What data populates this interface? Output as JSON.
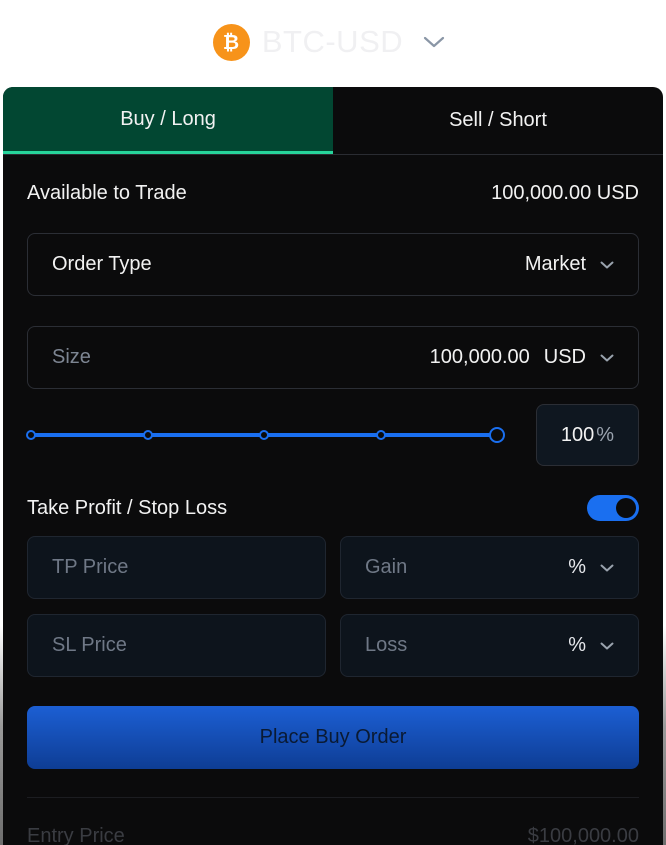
{
  "asset": {
    "name": "BTC-USD",
    "logo_symbol": "₿",
    "logo_color": "#f7931a"
  },
  "tabs": [
    {
      "label": "Buy / Long",
      "active": true
    },
    {
      "label": "Sell / Short",
      "active": false
    }
  ],
  "available": {
    "label": "Available to Trade",
    "value": "100,000.00 USD"
  },
  "order_type": {
    "label": "Order Type",
    "value": "Market"
  },
  "size": {
    "label": "Size",
    "value": "100,000.00",
    "unit": "USD"
  },
  "slider": {
    "percent_value": "100",
    "percent_sign": "%",
    "fraction": 1.0,
    "stops": 5
  },
  "tpsl": {
    "label": "Take Profit / Stop Loss",
    "enabled": true,
    "tp_placeholder": "TP Price",
    "gain_label": "Gain",
    "gain_unit": "%",
    "sl_placeholder": "SL Price",
    "loss_label": "Loss",
    "loss_unit": "%"
  },
  "place_order": {
    "label": "Place Buy Order"
  },
  "entry_price": {
    "label": "Entry Price",
    "value": "$100,000.00"
  },
  "colors": {
    "accent_green": "#27d49b",
    "active_tab_bg": "#024732",
    "accent_blue": "#1a6ff0",
    "panel_bg": "#0b0b0c"
  }
}
